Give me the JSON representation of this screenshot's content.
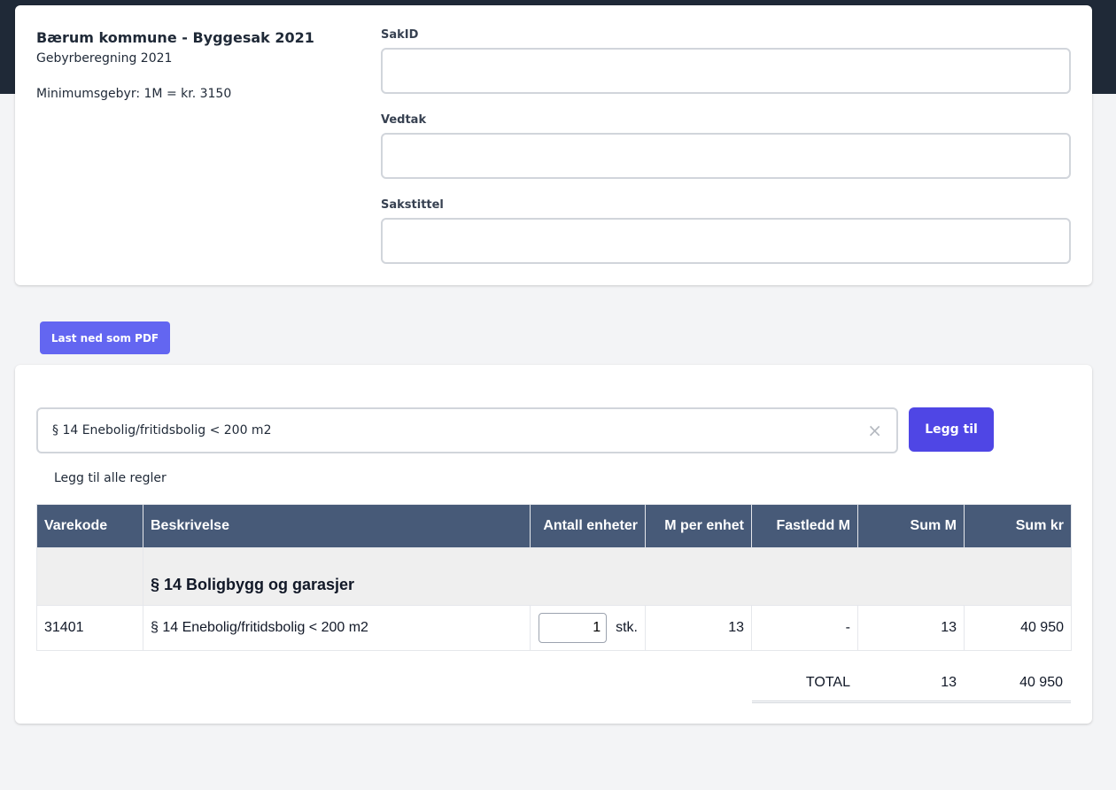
{
  "header": {
    "org_title": "Bærum kommune - Byggesak 2021",
    "subtitle": "Gebyrberegning 2021",
    "min_fee": "Minimumsgebyr: 1M = kr. 3150"
  },
  "form": {
    "sakid_label": "SakID",
    "sakid_value": "",
    "vedtak_label": "Vedtak",
    "vedtak_value": "",
    "sakstittel_label": "Sakstittel",
    "sakstittel_value": ""
  },
  "actions": {
    "pdf_button": "Last ned som PDF"
  },
  "rule_picker": {
    "selected": "§ 14 Enebolig/fritidsbolig < 200 m2",
    "clear_icon": "×",
    "add_button": "Legg til",
    "add_all_link": "Legg til alle regler"
  },
  "table": {
    "columns": [
      "Varekode",
      "Beskrivelse",
      "Antall enheter",
      "M per enhet",
      "Fastledd M",
      "Sum M",
      "Sum kr"
    ],
    "group": {
      "title": "§ 14 Boligbygg og garasjer"
    },
    "row": {
      "varekode": "31401",
      "beskrivelse": "§ 14 Enebolig/fritidsbolig < 200 m2",
      "antall": "1",
      "unit": "stk.",
      "m_per_enhet": "13",
      "fastledd": "-",
      "sum_m": "13",
      "sum_kr": "40 950"
    }
  },
  "totals": {
    "label": "TOTAL",
    "sum_m": "13",
    "sum_kr": "40 950"
  },
  "colors": {
    "topbar": "#1f2937",
    "table_header": "#475a78",
    "pdf_button": "#6366f1",
    "add_button": "#4f46e5"
  }
}
